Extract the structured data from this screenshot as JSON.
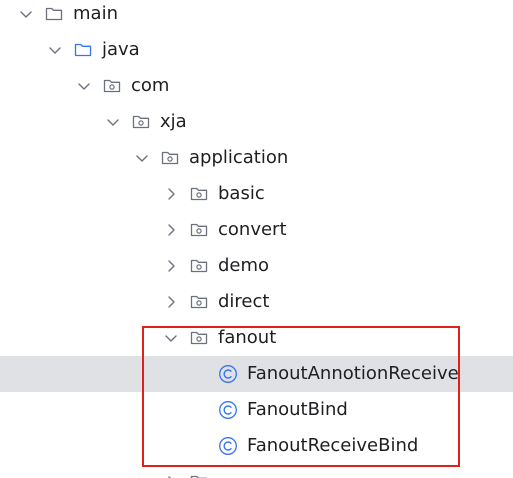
{
  "tree": {
    "rows": [
      {
        "label": "main",
        "icon": "folder-icon",
        "expanded": true
      },
      {
        "label": "java",
        "icon": "source-folder-icon",
        "expanded": true
      },
      {
        "label": "com",
        "icon": "package-icon",
        "expanded": true
      },
      {
        "label": "xja",
        "icon": "package-icon",
        "expanded": true
      },
      {
        "label": "application",
        "icon": "package-icon",
        "expanded": true
      },
      {
        "label": "basic",
        "icon": "package-icon",
        "expanded": false
      },
      {
        "label": "convert",
        "icon": "package-icon",
        "expanded": false
      },
      {
        "label": "demo",
        "icon": "package-icon",
        "expanded": false
      },
      {
        "label": "direct",
        "icon": "package-icon",
        "expanded": false
      },
      {
        "label": "fanout",
        "icon": "package-icon",
        "expanded": true
      },
      {
        "label": "FanoutAnnotionReceive",
        "icon": "class-icon",
        "selected": true
      },
      {
        "label": "FanoutBind",
        "icon": "class-icon"
      },
      {
        "label": "FanoutReceiveBind",
        "icon": "class-icon"
      },
      {
        "label": "",
        "icon": "package-icon",
        "expanded": false,
        "partial": true
      }
    ]
  },
  "colors": {
    "highlight_border": "#e0201a",
    "selected_row": "#dfe1e5",
    "class_icon": "#3574f0",
    "folder_icon": "#6c707e",
    "source_folder_icon": "#3574f0"
  }
}
